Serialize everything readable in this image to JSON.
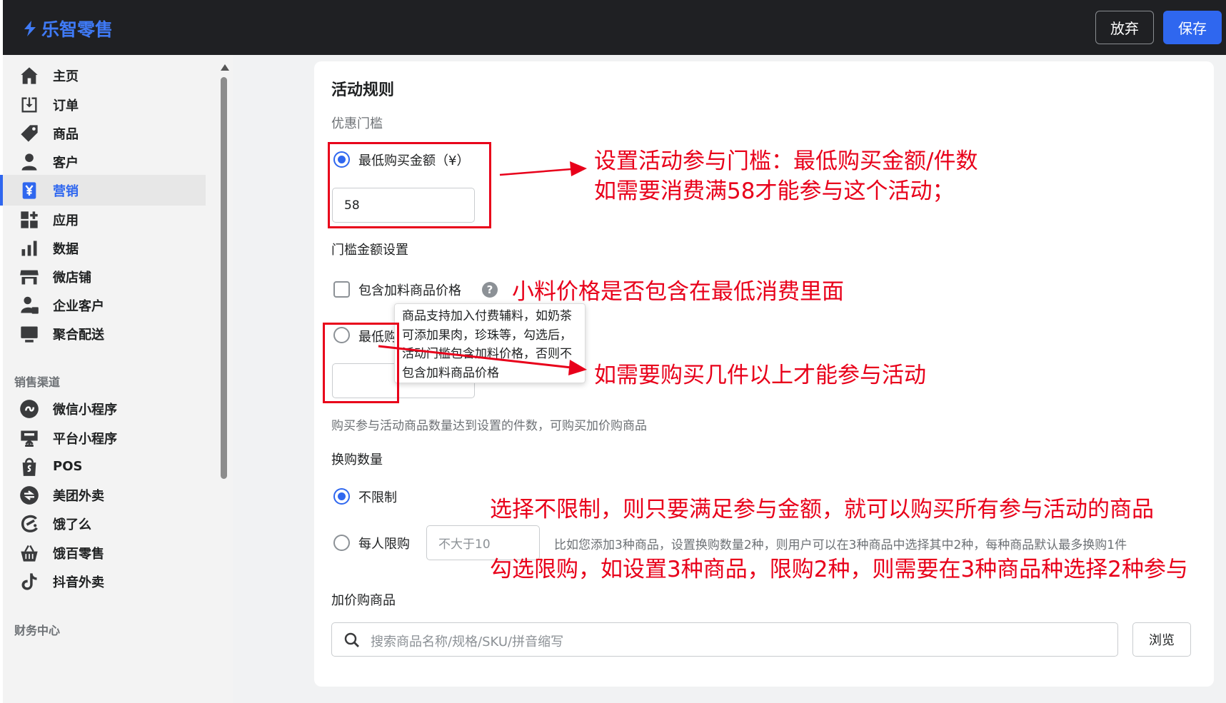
{
  "app": {
    "brand": "乐智零售"
  },
  "header": {
    "discard_label": "放弃",
    "save_label": "保存"
  },
  "sidebar": {
    "items": [
      {
        "label": "主页",
        "icon": "home-icon"
      },
      {
        "label": "订单",
        "icon": "order-icon"
      },
      {
        "label": "商品",
        "icon": "tag-icon"
      },
      {
        "label": "客户",
        "icon": "person-icon"
      },
      {
        "label": "营销",
        "icon": "yen-icon",
        "active": true
      },
      {
        "label": "应用",
        "icon": "apps-icon"
      },
      {
        "label": "数据",
        "icon": "bar-chart-icon"
      },
      {
        "label": "微店铺",
        "icon": "store-icon"
      },
      {
        "label": "企业客户",
        "icon": "enterprise-user-icon"
      },
      {
        "label": "聚合配送",
        "icon": "monitor-icon"
      }
    ],
    "sales_channel_title": "销售渠道",
    "channels": [
      {
        "label": "微信小程序",
        "icon": "wechat-miniprogram-icon"
      },
      {
        "label": "平台小程序",
        "icon": "platform-miniprogram-icon"
      },
      {
        "label": "POS",
        "icon": "shopping-bag-icon"
      },
      {
        "label": "美团外卖",
        "icon": "meituan-icon"
      },
      {
        "label": "饿了么",
        "icon": "eleme-icon"
      },
      {
        "label": "饿百零售",
        "icon": "basket-icon"
      },
      {
        "label": "抖音外卖",
        "icon": "douyin-icon"
      }
    ],
    "finance_title": "财务中心"
  },
  "rules": {
    "title": "活动规则",
    "threshold_label": "优惠门槛",
    "min_amount_option": "最低购买金额（¥）",
    "min_amount_value": "58",
    "threshold_amount_settings": "门槛金额设置",
    "include_addon_label": "包含加料商品价格",
    "help_glyph": "?",
    "min_qty_option_visible": "最低购",
    "tooltip_text": "商品支持加入付费辅料，如奶茶可添加果肉，珍珠等，勾选后，活动门槛包含加料价格，否则不包含加料商品价格",
    "quantity_hint": "购买参与活动商品数量达到设置的件数，可购买加价购商品",
    "exchange_qty_label": "换购数量",
    "unlimited_option": "不限制",
    "per_person_option": "每人限购",
    "per_person_placeholder": "不大于10",
    "per_person_hint": "比如您添加3种商品，设置换购数量2种，则用户可以在3种商品中选择其中2种，每种商品默认最多换购1件",
    "addon_products_label": "加价购商品",
    "search_placeholder": "搜索商品名称/规格/SKU/拼音缩写",
    "browse_label": "浏览"
  },
  "annotations": {
    "note1_line1": "设置活动参与门槛：最低购买金额/件数",
    "note1_line2": "如需要消费满58才能参与这个活动；",
    "note2": "小料价格是否包含在最低消费里面",
    "note3": "如需要购买几件以上才能参与活动",
    "note4": "选择不限制，则只要满足参与金额，就可以购买所有参与活动的商品",
    "note5": "勾选限购，如设置3种商品，限购2种，则需要在3种商品种选择2种参与"
  },
  "colors": {
    "accent": "#2f67ef",
    "annotation_red": "#e8001a",
    "topbar": "#1f2023"
  }
}
